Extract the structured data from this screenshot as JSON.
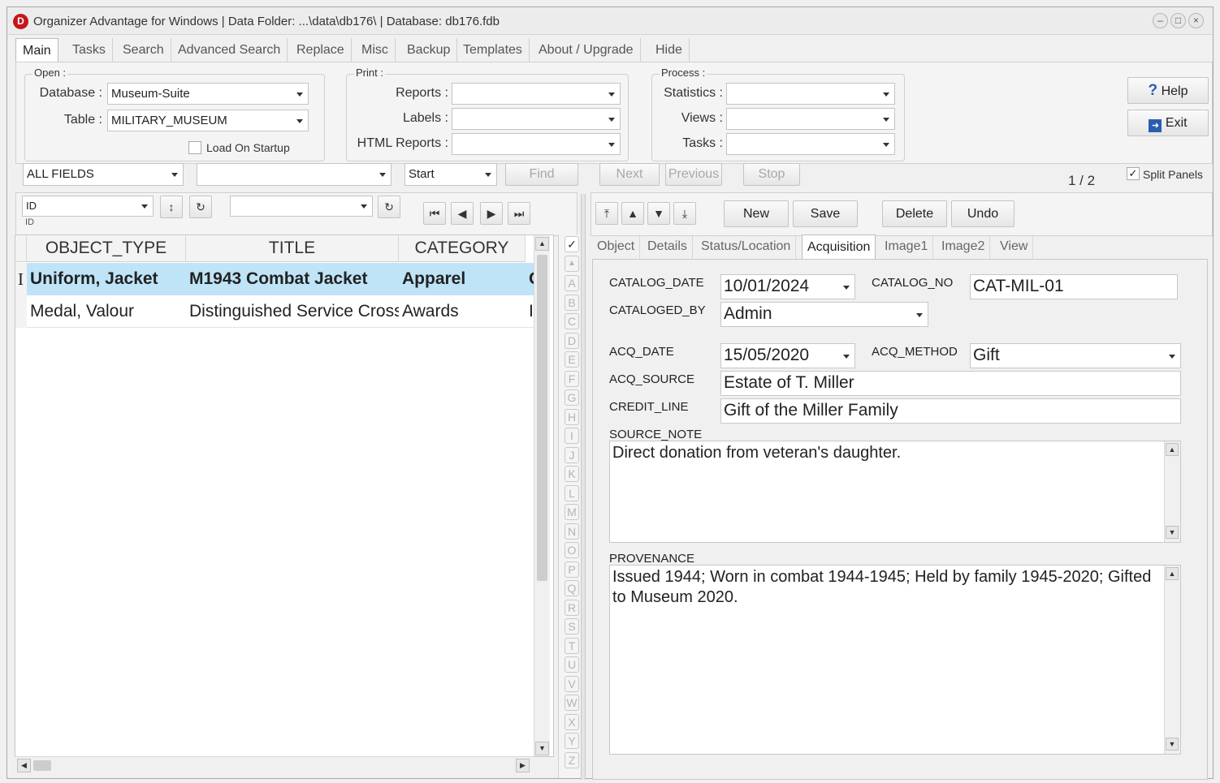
{
  "window": {
    "title": "Organizer Advantage for Windows | Data Folder: ...\\data\\db176\\ | Database: db176.fdb",
    "app_icon_letter": "D"
  },
  "tabs": [
    "Main",
    "Tasks",
    "Search",
    "Advanced Search",
    "Replace",
    "Misc",
    "Backup",
    "Templates",
    "About / Upgrade",
    "Hide"
  ],
  "open_group": {
    "label": "Open :",
    "database_label": "Database :",
    "database_value": "Museum-Suite",
    "table_label": "Table :",
    "table_value": "MILITARY_MUSEUM",
    "load_on_startup_label": "Load On Startup"
  },
  "print_group": {
    "label": "Print :",
    "reports_label": "Reports :",
    "labels_label": "Labels :",
    "html_reports_label": "HTML Reports :"
  },
  "process_group": {
    "label": "Process :",
    "statistics_label": "Statistics :",
    "views_label": "Views :",
    "tasks_label": "Tasks :"
  },
  "help_button": "Help",
  "exit_button": "Exit",
  "search_bar": {
    "field_value": "ALL FIELDS",
    "search_value": "",
    "match_value": "Start",
    "find": "Find",
    "next": "Next",
    "previous": "Previous",
    "stop": "Stop",
    "record_counter": "1 / 2",
    "split_panels_label": "Split Panels",
    "split_panels_checked": true
  },
  "sort_bar": {
    "sort_field": "ID",
    "sort_field_sub": "ID",
    "filter_value": ""
  },
  "record_buttons": {
    "new": "New",
    "save": "Save",
    "delete": "Delete",
    "undo": "Undo"
  },
  "grid": {
    "columns": [
      "OBJECT_TYPE",
      "TITLE",
      "CATEGORY"
    ],
    "rows": [
      {
        "indicator": "I",
        "object_type": "Uniform, Jacket",
        "title": "M1943 Combat Jacket",
        "category": "Apparel",
        "overflow": "C",
        "selected": true
      },
      {
        "indicator": "",
        "object_type": "Medal, Valour",
        "title": "Distinguished Service Cross",
        "category": "Awards",
        "overflow": "I",
        "selected": false
      }
    ]
  },
  "alphabet": [
    "A",
    "B",
    "C",
    "D",
    "E",
    "F",
    "G",
    "H",
    "I",
    "J",
    "K",
    "L",
    "M",
    "N",
    "O",
    "P",
    "Q",
    "R",
    "S",
    "T",
    "U",
    "V",
    "W",
    "X",
    "Y",
    "Z"
  ],
  "detail_tabs": [
    "Object",
    "Details",
    "Status/Location",
    "Acquisition",
    "Image1",
    "Image2",
    "View"
  ],
  "acquisition": {
    "catalog_date_label": "CATALOG_DATE",
    "catalog_date": "10/01/2024",
    "catalog_no_label": "CATALOG_NO",
    "catalog_no": "CAT-MIL-01",
    "cataloged_by_label": "CATALOGED_BY",
    "cataloged_by": "Admin",
    "acq_date_label": "ACQ_DATE",
    "acq_date": "15/05/2020",
    "acq_method_label": "ACQ_METHOD",
    "acq_method": "Gift",
    "acq_source_label": "ACQ_SOURCE",
    "acq_source": "Estate of T. Miller",
    "credit_line_label": "CREDIT_LINE",
    "credit_line": "Gift of the Miller Family",
    "source_note_label": "SOURCE_NOTE",
    "source_note": "Direct donation from veteran's daughter.",
    "provenance_label": "PROVENANCE",
    "provenance": "Issued 1944; Worn in combat 1944-1945; Held by family 1945-2020; Gifted to Museum 2020."
  }
}
